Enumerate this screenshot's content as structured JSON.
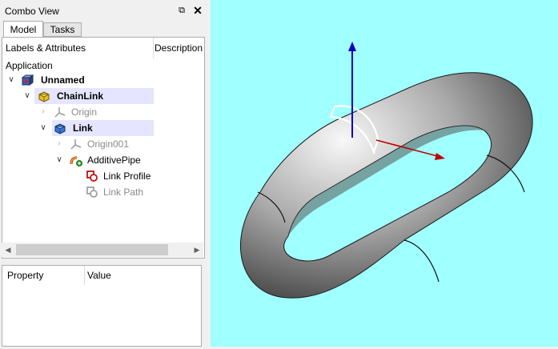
{
  "panel": {
    "title": "Combo View",
    "float_icon": "⧉",
    "close_icon": "✕"
  },
  "tabs": [
    {
      "label": "Model",
      "active": true
    },
    {
      "label": "Tasks",
      "active": false
    }
  ],
  "tree": {
    "headers": {
      "labels": "Labels & Attributes",
      "description": "Description"
    },
    "root_label": "Application",
    "items": [
      {
        "label": "Unnamed",
        "icon": "document-icon",
        "expanded": true
      },
      {
        "label": "ChainLink",
        "icon": "body-icon",
        "expanded": true,
        "selected": true
      },
      {
        "label": "Origin",
        "icon": "origin-icon",
        "expanded": false
      },
      {
        "label": "Link",
        "icon": "body-icon",
        "expanded": true,
        "selected": true
      },
      {
        "label": "Origin001",
        "icon": "origin-icon",
        "expanded": false
      },
      {
        "label": "AdditivePipe",
        "icon": "additive-pipe-icon",
        "expanded": true
      },
      {
        "label": "Link Profile",
        "icon": "sketch-icon"
      },
      {
        "label": "Link Path",
        "icon": "sketch-icon"
      }
    ]
  },
  "properties": {
    "headers": {
      "property": "Property",
      "value": "Value"
    }
  },
  "colors": {
    "viewport_background": "#a0ffff",
    "selection_background": "#e5e5ff",
    "axis_x": "#c00000",
    "axis_z": "#0000c0"
  }
}
